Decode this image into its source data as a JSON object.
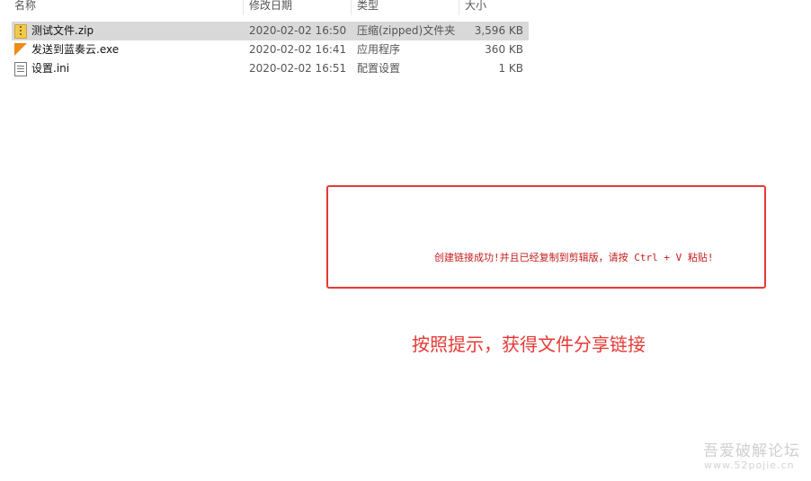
{
  "columns": {
    "name": "名称",
    "date": "修改日期",
    "type": "类型",
    "size": "大小"
  },
  "files": [
    {
      "name": "测试文件.zip",
      "date": "2020-02-02 16:50",
      "type": "压缩(zipped)文件夹",
      "size": "3,596 KB",
      "icon": "zip-file-icon",
      "selected": true
    },
    {
      "name": "发送到蓝奏云.exe",
      "date": "2020-02-02 16:41",
      "type": "应用程序",
      "size": "360 KB",
      "icon": "exe-file-icon",
      "selected": false
    },
    {
      "name": "设置.ini",
      "date": "2020-02-02 16:51",
      "type": "配置设置",
      "size": "1 KB",
      "icon": "ini-file-icon",
      "selected": false
    }
  ],
  "notice": {
    "text": "创建链接成功!并且已经复制到剪辑版，请按 Ctrl + V 粘贴!"
  },
  "instruction": "按照提示，获得文件分享链接",
  "watermark": {
    "line1": "吾爱破解论坛",
    "line2": "www.52pojie.cn"
  },
  "colors": {
    "accent_red": "#e53935",
    "selection": "#d9d9d9"
  }
}
